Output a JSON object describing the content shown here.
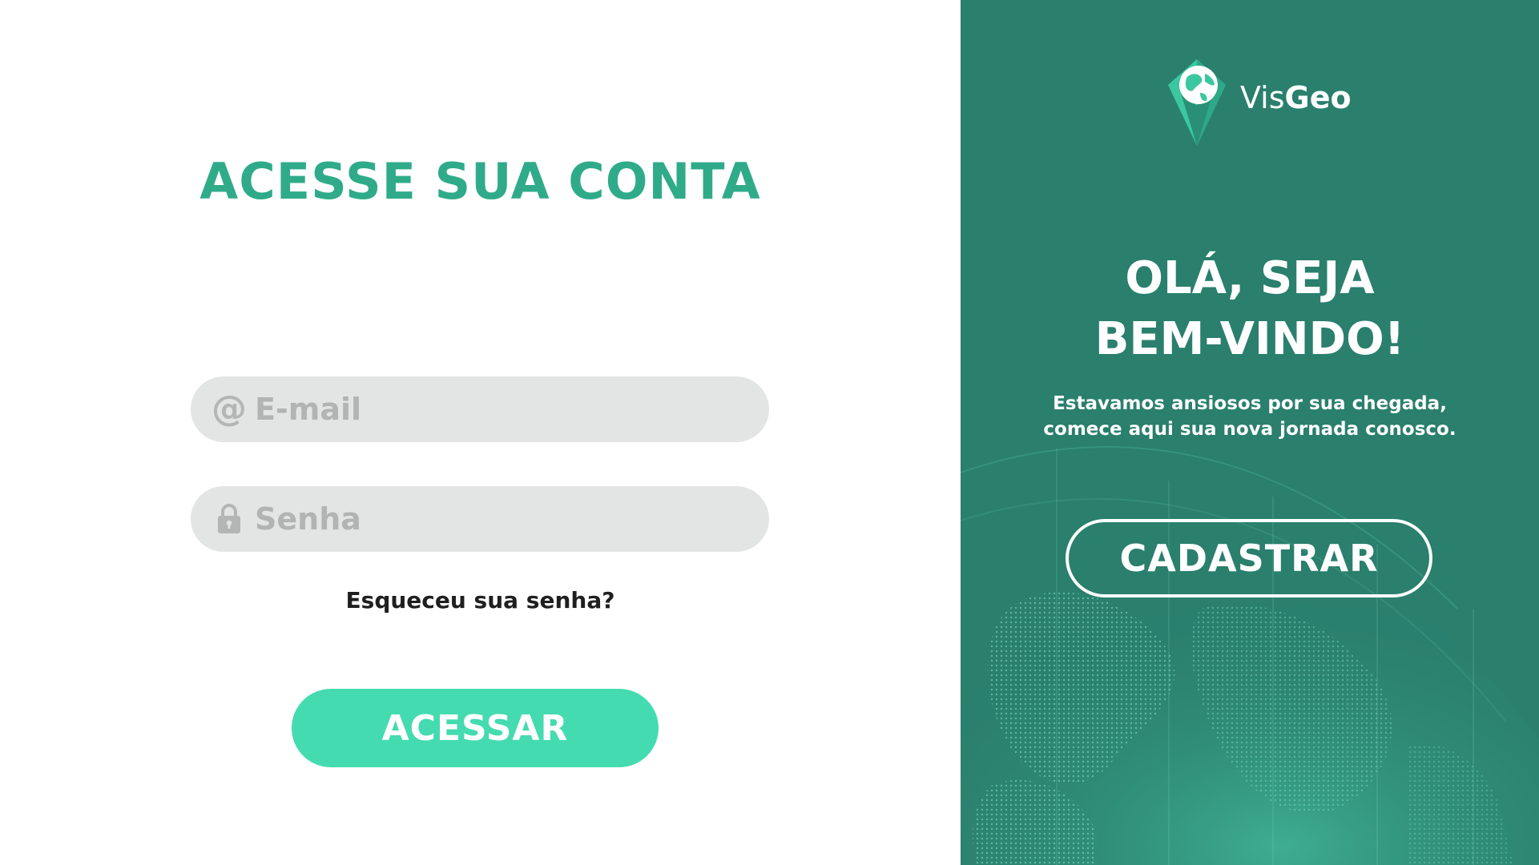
{
  "login": {
    "title": "ACESSE SUA CONTA",
    "email_placeholder": "E-mail",
    "email_value": "",
    "password_placeholder": "Senha",
    "password_value": "",
    "forgot_label": "Esqueceu sua senha?",
    "submit_label": "ACESSAR"
  },
  "welcome": {
    "brand_light": "Vis",
    "brand_bold": "Geo",
    "title_line1": "OLÁ, SEJA",
    "title_line2": "BEM-VINDO!",
    "text_line1": "Estavamos ansiosos por sua chegada,",
    "text_line2": "comece aqui sua nova jornada conosco.",
    "register_label": "CADASTRAR"
  },
  "icons": {
    "email": "at-icon",
    "password": "lock-icon",
    "logo": "globe-diamond-logo"
  },
  "colors": {
    "accent": "#2fab8a",
    "button": "#44dbb0",
    "panel": "#2a7f6d",
    "field_bg": "#e3e4e4",
    "placeholder": "#b2b3b3"
  }
}
